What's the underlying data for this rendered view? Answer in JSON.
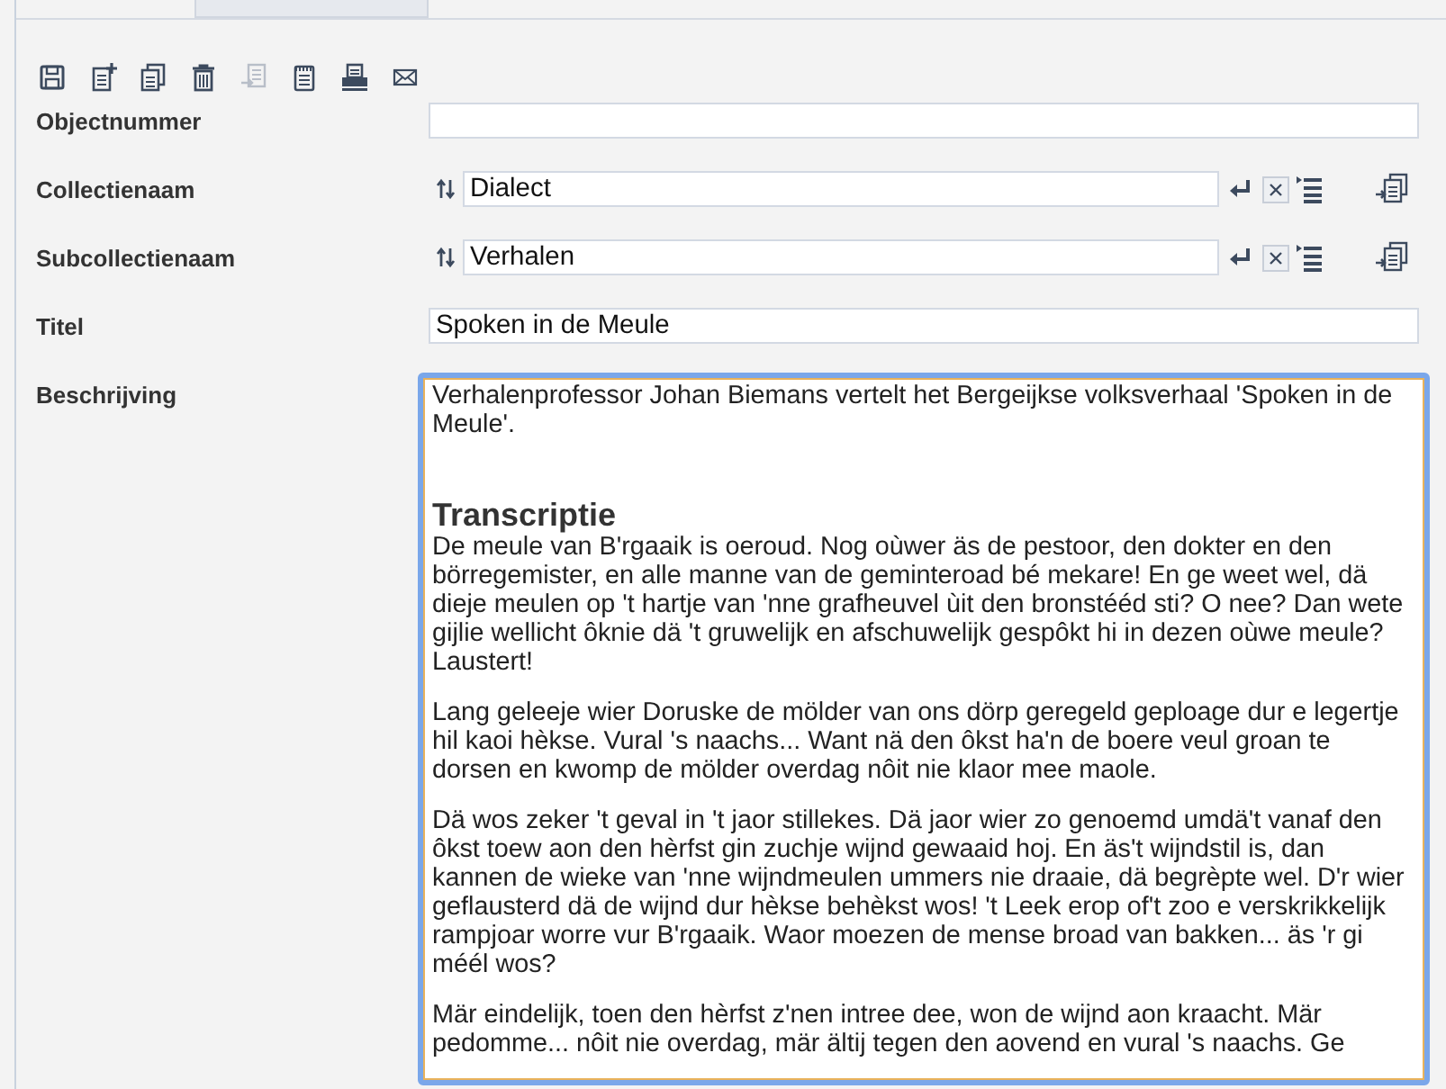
{
  "toolbar": [
    {
      "kind": "save",
      "disabled": false
    },
    {
      "kind": "new",
      "disabled": false
    },
    {
      "kind": "copy",
      "disabled": false
    },
    {
      "kind": "delete",
      "disabled": false
    },
    {
      "kind": "derive",
      "disabled": true
    },
    {
      "kind": "notes",
      "disabled": false
    },
    {
      "kind": "print",
      "disabled": false
    },
    {
      "kind": "mail",
      "disabled": false
    }
  ],
  "fields": [
    {
      "label": "Objectnummer",
      "kind": "text"
    },
    {
      "label": "Collectienaam",
      "kind": "linked",
      "value": "Dialect"
    },
    {
      "label": "Subcollectienaam",
      "kind": "linked",
      "value": "Verhalen"
    },
    {
      "label": "Titel",
      "kind": "text",
      "value": "Spoken in de Meule"
    },
    {
      "label": "Beschrijving",
      "kind": "richtext",
      "blocks": [
        {
          "kind": "paragraph",
          "text": "Verhalenprofessor Johan Biemans vertelt het Bergeijkse volksverhaal 'Spoken in de Meule'."
        },
        {
          "kind": "heading",
          "text": "Transcriptie"
        },
        {
          "kind": "paragraph",
          "text": "De meule van B'rgaaik is oeroud. Nog oùwer äs de pestoor, den dokter en den börregemister, en alle manne van de geminteroad bé mekare! En ge weet wel, dä dieje meulen op 't hartje van 'nne grafheuvel ùit den bronstééd sti? O nee? Dan wete gijlie wellicht ôknie dä 't gruwelijk en afschuwelijk gespôkt hi in dezen oùwe meule? Laustert!"
        },
        {
          "kind": "paragraph",
          "text": "Lang geleeje wier Doruske de mölder van ons dörp geregeld geploage dur e legertje hil kaoi hèkse. Vural 's naachs... Want nä den ôkst ha'n de boere veul groan te dorsen en kwomp de mölder overdag nôit nie klaor mee maole."
        },
        {
          "kind": "paragraph",
          "text": "Dä wos zeker 't geval in 't jaor stillekes. Dä jaor wier zo genoemd umdä't vanaf den ôkst toew aon den hèrfst gin zuchje wijnd gewaaid hoj. En äs't wijndstil is, dan kannen de wieke van 'nne wijndmeulen ummers nie draaie, dä begrèpte wel. D'r wier geflausterd dä de wijnd dur hèkse behèkst wos! 't Leek erop of't zoo e verskrikkelijk rampjoar worre vur B'rgaaik. Waor moezen de mense broad van bakken... äs 'r gi méél wos?"
        },
        {
          "kind": "paragraph",
          "text": "Mär eindelijk, toen den hèrfst z'nen intree dee, won de wijnd aon kraacht. Mär pedomme... nôit nie overdag, mär ältij tegen den aovend en vural 's naachs. Ge"
        }
      ]
    }
  ]
}
